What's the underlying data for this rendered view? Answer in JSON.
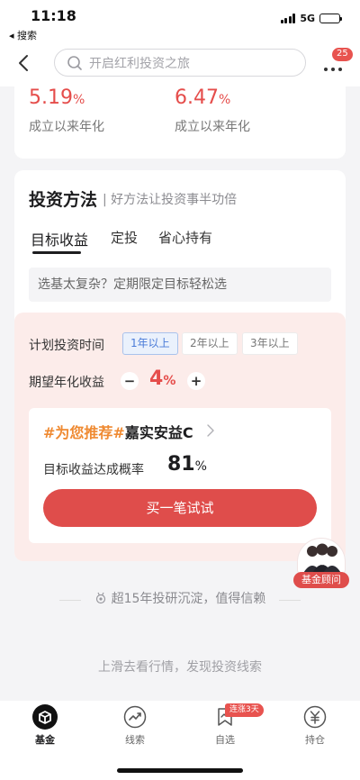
{
  "status_bar": {
    "time": "11:18",
    "back_label": "◂ 搜索",
    "network": "5G",
    "battery_level": 0.6
  },
  "nav": {
    "search_placeholder": "开启红利投资之旅",
    "message_badge": "25"
  },
  "returns": [
    {
      "value": "5.19",
      "unit": "%",
      "label": "成立以来年化"
    },
    {
      "value": "6.47",
      "unit": "%",
      "label": "成立以来年化"
    }
  ],
  "method": {
    "title": "投资方法",
    "subtitle": "| 好方法让投资事半功倍",
    "tabs": [
      "目标收益",
      "定投",
      "省心持有"
    ],
    "active_tab": "目标收益",
    "tip": "选基太复杂？定期限定目标轻松选",
    "plan": {
      "period_label": "计划投资时间",
      "periods": [
        "1年以上",
        "2年以上",
        "3年以上"
      ],
      "selected_period": "1年以上",
      "expect_label": "期望年化收益",
      "minus": "−",
      "plus": "+",
      "expect_value": "4",
      "expect_unit": "%"
    },
    "recommend": {
      "tag": "#为您推荐#",
      "fund_name": "嘉实安益C",
      "prob_label": "目标收益达成概率",
      "prob_value": "81",
      "prob_unit": "%",
      "button": "买一笔试试"
    }
  },
  "advisor": {
    "label": "基金顾问"
  },
  "trust": {
    "text": "超15年投研沉淀，值得信赖"
  },
  "swipe_hint": "上滑去看行情，发现投资线索",
  "tabbar": {
    "items": [
      {
        "label": "基金",
        "icon": "fund-icon",
        "active": true
      },
      {
        "label": "线索",
        "icon": "trend-icon",
        "active": false
      },
      {
        "label": "自选",
        "icon": "bookmark-icon",
        "active": false
      },
      {
        "label": "持仓",
        "icon": "yen-icon",
        "active": false
      }
    ],
    "badge": "连涨3天"
  },
  "colors": {
    "accent_red": "#df4d4b",
    "highlight_orange": "#ef8a32",
    "plan_bg": "#fcecea",
    "selected_blue": "#4a7bd8"
  }
}
